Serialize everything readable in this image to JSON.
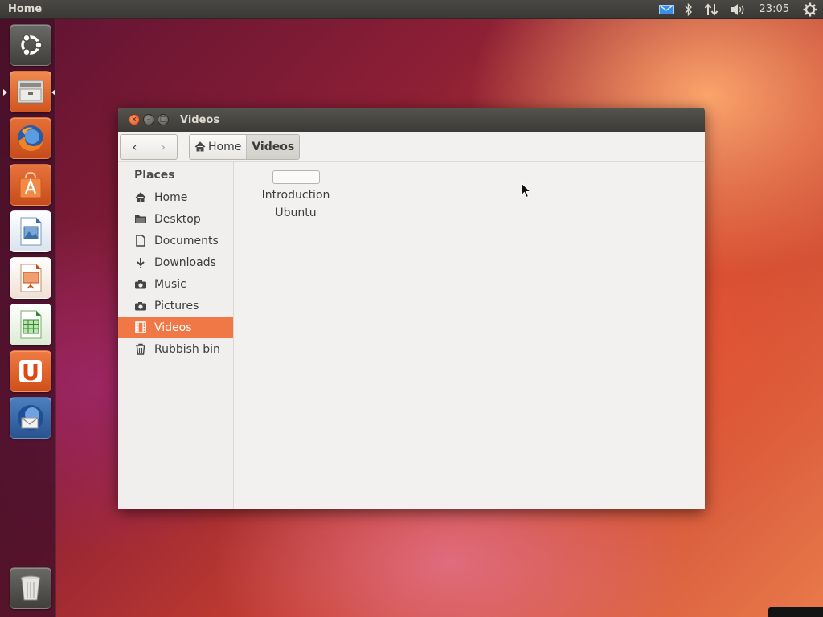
{
  "panel": {
    "title": "Home",
    "clock": "23:05",
    "indicators": [
      "mail-icon",
      "bluetooth-icon",
      "network-icon",
      "volume-icon",
      "session-gear-icon"
    ]
  },
  "launcher": {
    "items": [
      {
        "name": "Dash home",
        "icon": "ubuntu-logo-icon"
      },
      {
        "name": "Files",
        "icon": "file-cabinet-icon",
        "running": true
      },
      {
        "name": "Firefox",
        "icon": "firefox-icon"
      },
      {
        "name": "Ubuntu Software Centre",
        "icon": "software-centre-icon"
      },
      {
        "name": "LibreOffice Draw",
        "icon": "libreoffice-draw-icon"
      },
      {
        "name": "LibreOffice Impress",
        "icon": "libreoffice-impress-icon"
      },
      {
        "name": "LibreOffice Calc",
        "icon": "libreoffice-calc-icon"
      },
      {
        "name": "Ubuntu One",
        "icon": "ubuntu-one-icon"
      },
      {
        "name": "Thunderbird",
        "icon": "thunderbird-icon"
      },
      {
        "name": "Rubbish bin",
        "icon": "trash-icon"
      }
    ]
  },
  "window": {
    "title": "Videos",
    "close_glyph": "×",
    "minimize_glyph": "–",
    "maximize_glyph": "□",
    "back_glyph": "‹",
    "forward_glyph": "›",
    "breadcrumbs": [
      "Home",
      "Videos"
    ],
    "sidebar": {
      "heading": "Places",
      "items": [
        {
          "label": "Home",
          "icon": "home-icon"
        },
        {
          "label": "Desktop",
          "icon": "desktop-folder-icon"
        },
        {
          "label": "Documents",
          "icon": "document-icon"
        },
        {
          "label": "Downloads",
          "icon": "download-icon"
        },
        {
          "label": "Music",
          "icon": "music-icon"
        },
        {
          "label": "Pictures",
          "icon": "camera-icon"
        },
        {
          "label": "Videos",
          "icon": "film-icon",
          "selected": true
        },
        {
          "label": "Rubbish bin",
          "icon": "trash-icon"
        }
      ]
    },
    "files": [
      {
        "name_line1": "Introduction",
        "name_line2": "Ubuntu"
      }
    ]
  },
  "colors": {
    "accent": "#f07746",
    "panel": "#3c3b37",
    "launcher": "#46102a"
  }
}
